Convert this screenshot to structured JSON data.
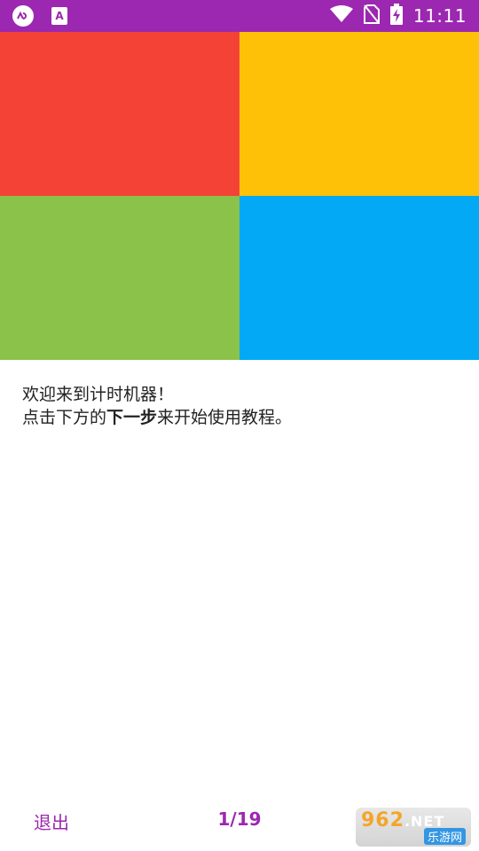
{
  "status_bar": {
    "time": "11:11",
    "left_icons": [
      "cloud-app-icon",
      "font-app-icon"
    ],
    "right_icons": [
      "wifi-icon",
      "no-sim-icon",
      "battery-charging-icon"
    ],
    "color": "#9c27b0"
  },
  "tiles": {
    "colors": [
      "#f44336",
      "#ffc107",
      "#8bc34a",
      "#03a9f4"
    ]
  },
  "intro": {
    "line1": "欢迎来到计时机器！",
    "line2_prefix": "点击下方的",
    "line2_bold": "下一步",
    "line2_suffix": "来开始使用教程。"
  },
  "nav": {
    "exit_label": "退出",
    "page_counter": "1/19",
    "accent": "#9c27b0"
  },
  "watermark": {
    "brand": "962",
    "suffix": ".NET",
    "subtitle": "乐游网"
  }
}
